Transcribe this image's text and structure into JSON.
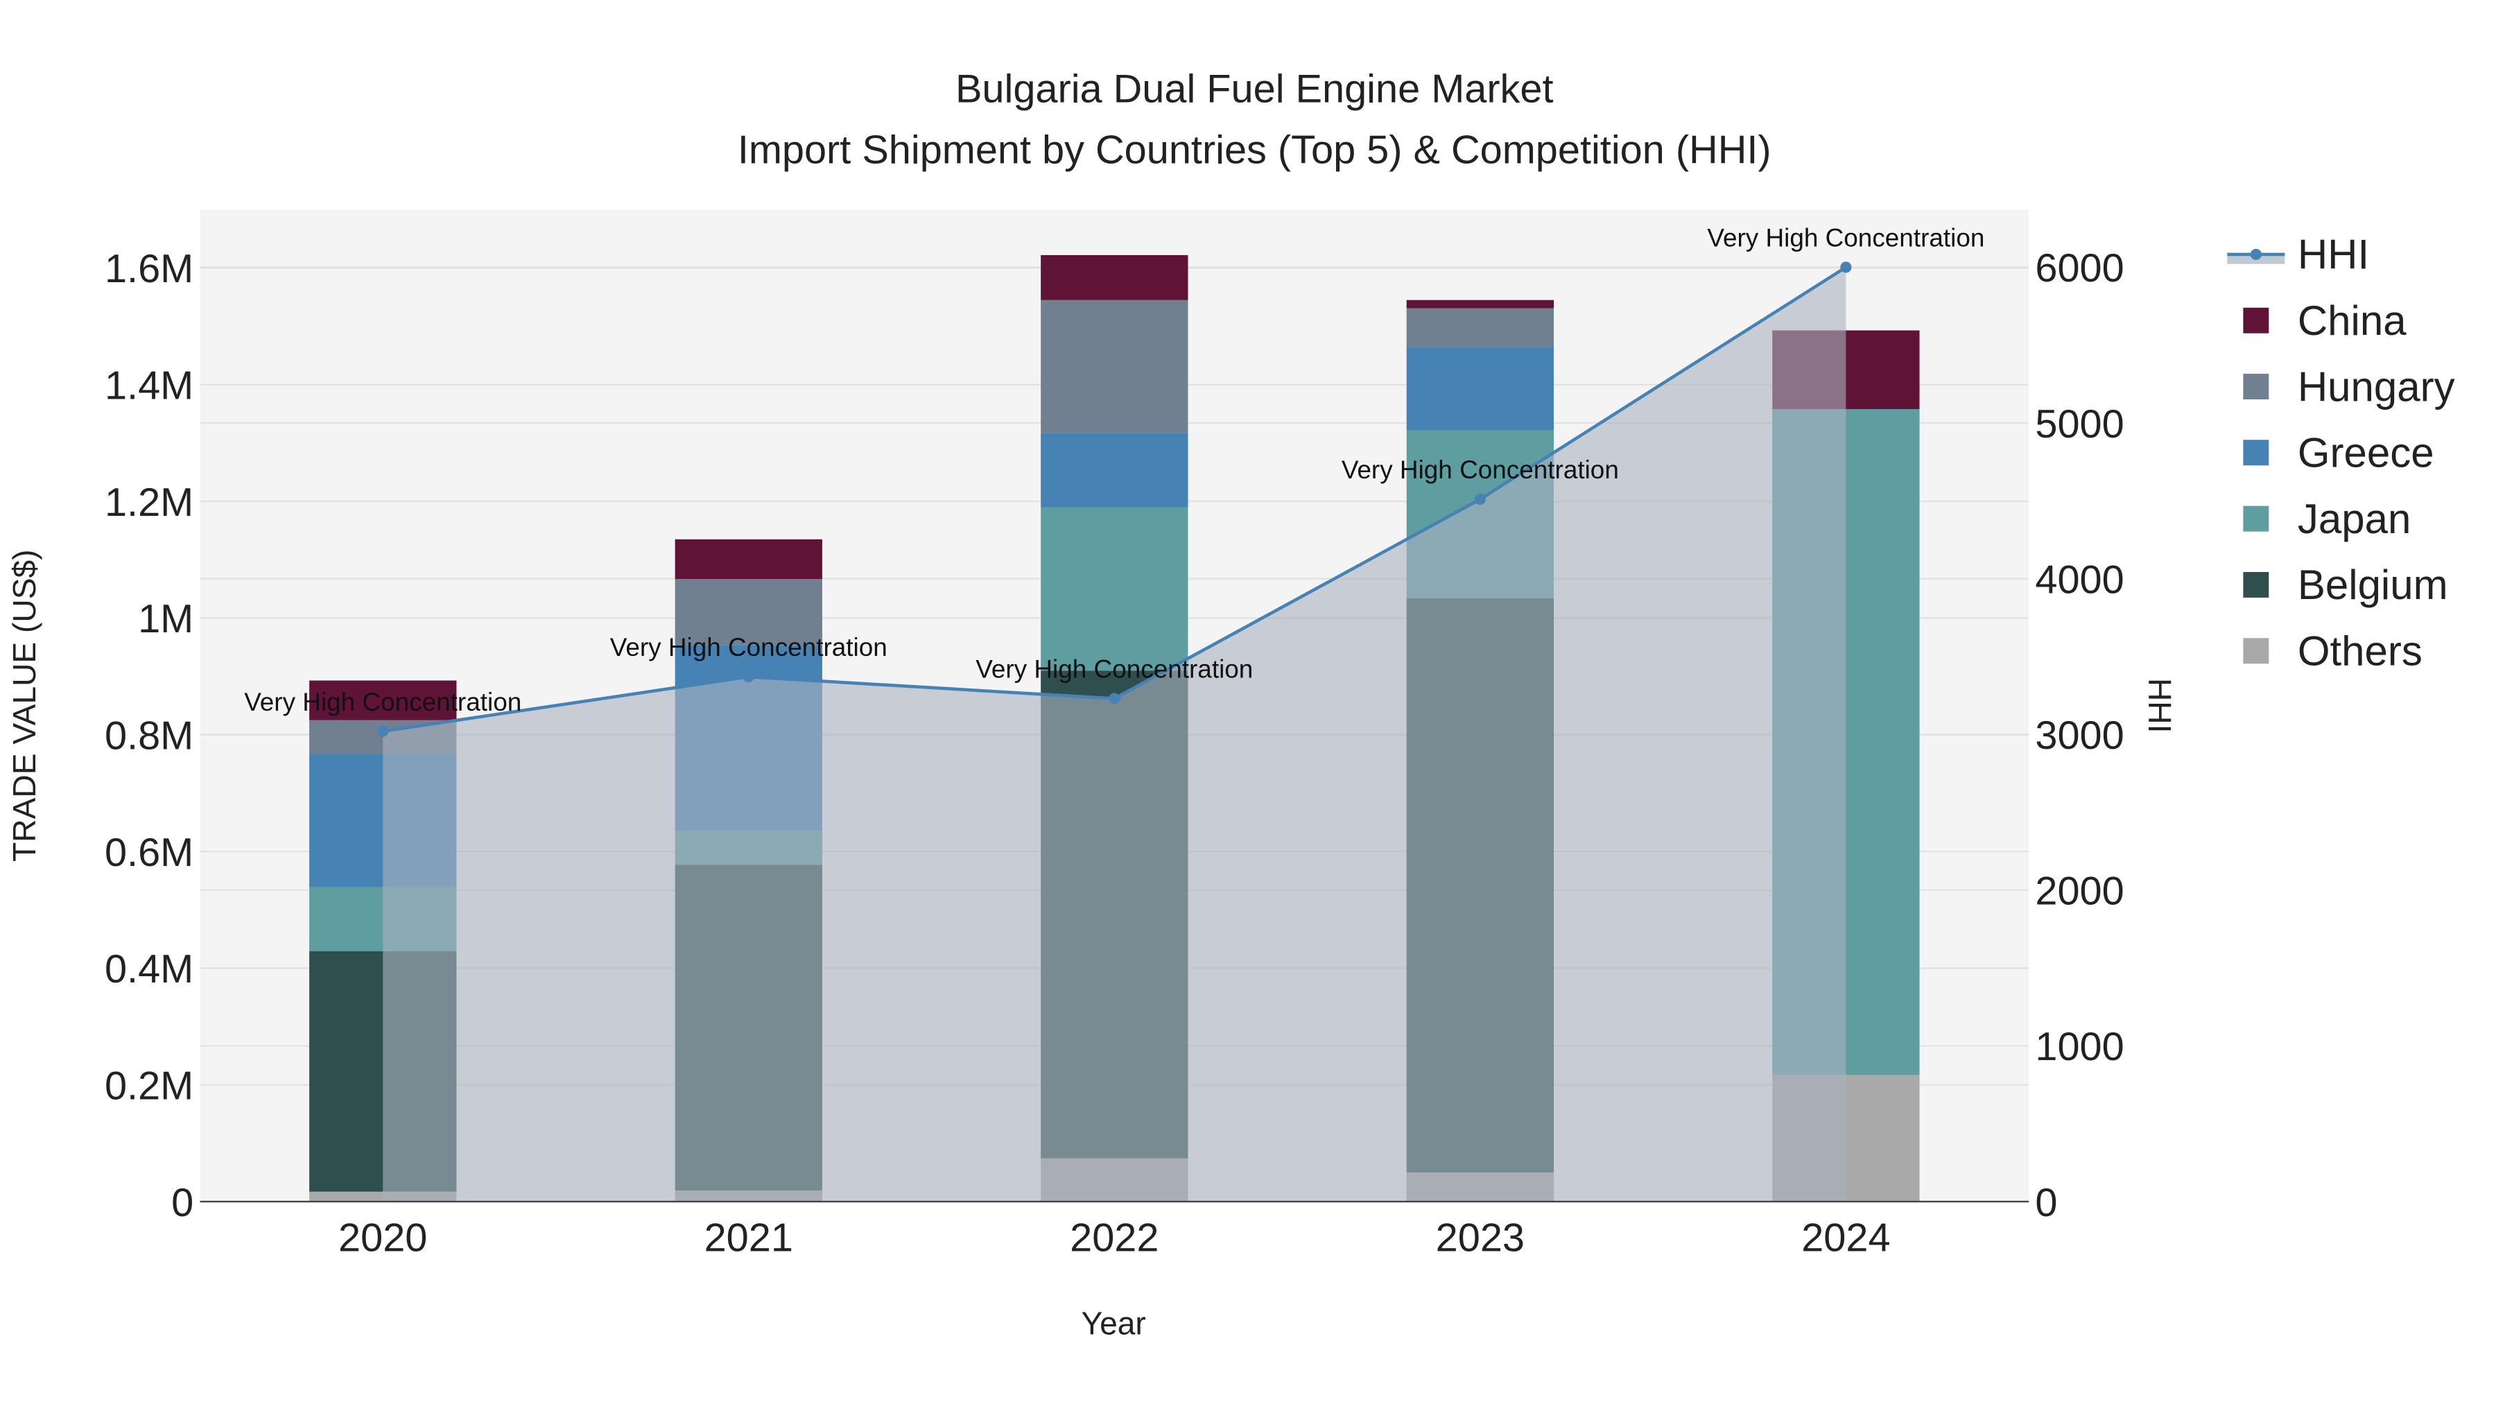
{
  "chart_data": {
    "type": "bar",
    "stacked": true,
    "title_line1": "Bulgaria Dual Fuel Engine Market",
    "title_line2": "Import Shipment by Countries (Top 5) & Competition (HHI)",
    "xlabel": "Year",
    "ylabel": "TRADE VALUE (US$)",
    "y2label": "HHI",
    "categories": [
      "2020",
      "2021",
      "2022",
      "2023",
      "2024"
    ],
    "ylim": [
      0,
      1700000
    ],
    "y_ticks": [
      0,
      200000,
      400000,
      600000,
      800000,
      1000000,
      1200000,
      1400000,
      1600000
    ],
    "y_tick_labels": [
      "0",
      "0.2M",
      "0.4M",
      "0.6M",
      "0.8M",
      "1M",
      "1.2M",
      "1.4M",
      "1.6M"
    ],
    "y2lim": [
      0,
      6370
    ],
    "y2_ticks": [
      0,
      1000,
      2000,
      3000,
      4000,
      5000,
      6000
    ],
    "y2_tick_labels": [
      "0",
      "1000",
      "2000",
      "3000",
      "4000",
      "5000",
      "6000"
    ],
    "grid": true,
    "legend_position": "right",
    "series": [
      {
        "name": "Others",
        "color": "#a9a9a9",
        "values": [
          17000,
          19000,
          74000,
          50000,
          217000
        ]
      },
      {
        "name": "Belgium",
        "color": "#2f4f4f",
        "values": [
          412000,
          558000,
          836000,
          984000,
          0
        ]
      },
      {
        "name": "Japan",
        "color": "#5f9ea0",
        "values": [
          110000,
          58000,
          280000,
          288000,
          1141000
        ]
      },
      {
        "name": "Greece",
        "color": "#4682b4",
        "values": [
          228000,
          319000,
          127000,
          143000,
          0
        ]
      },
      {
        "name": "Hungary",
        "color": "#708090",
        "values": [
          58000,
          113000,
          228000,
          66000,
          0
        ]
      },
      {
        "name": "China",
        "color": "#5f1336",
        "values": [
          68000,
          68000,
          77000,
          14000,
          135000
        ]
      }
    ],
    "hhi": {
      "name": "HHI",
      "color": "#4682b4",
      "values": [
        3020,
        3370,
        3230,
        4510,
        6000
      ],
      "annotations": [
        "Very High Concentration",
        "Very High Concentration",
        "Very High Concentration",
        "Very High Concentration",
        "Very High Concentration"
      ]
    },
    "legend": [
      "HHI",
      "China",
      "Hungary",
      "Greece",
      "Japan",
      "Belgium",
      "Others"
    ]
  }
}
